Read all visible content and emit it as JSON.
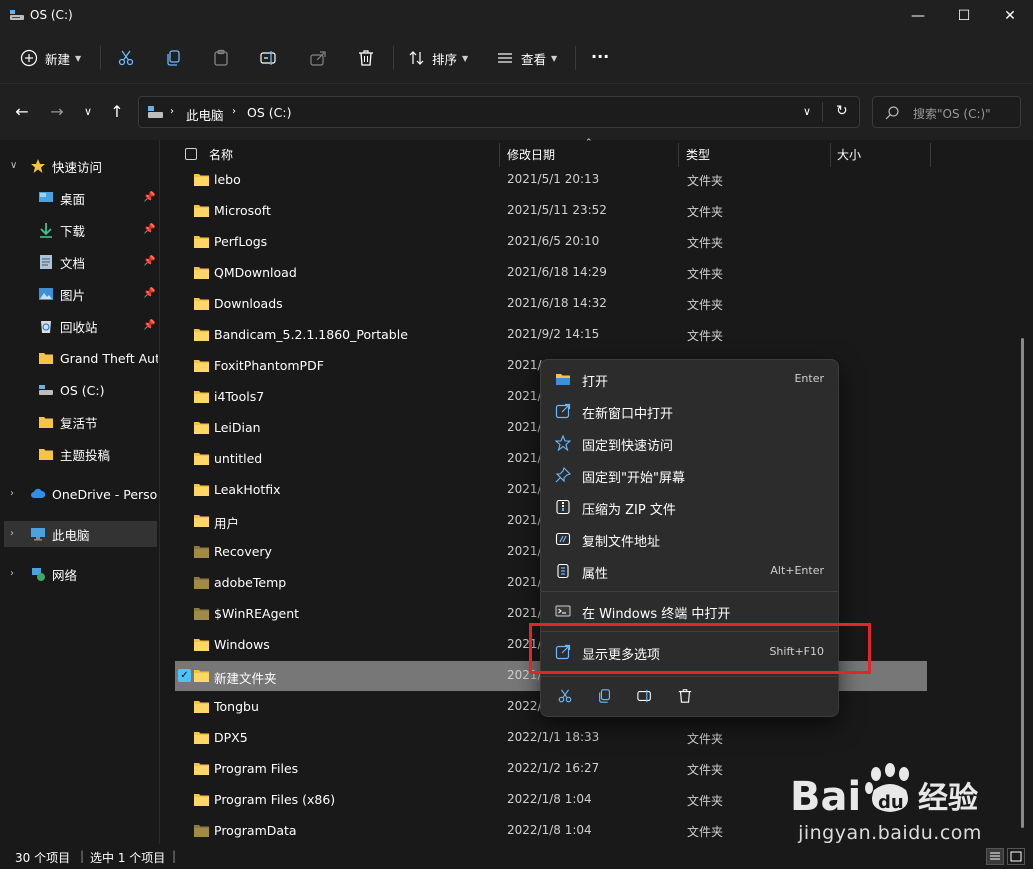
{
  "window": {
    "title": "OS (C:)",
    "minimize_label": "—",
    "maximize_label": "☐",
    "close_label": "✕"
  },
  "toolbar": {
    "new_label": "新建",
    "sort_label": "排序",
    "view_label": "查看",
    "more_label": "···"
  },
  "address": {
    "crumbs": [
      "此电脑",
      "OS (C:)"
    ],
    "search_placeholder": "搜索\"OS (C:)\""
  },
  "sidebar": {
    "items": [
      {
        "label": "快速访问",
        "icon": "star-icon"
      },
      {
        "label": "桌面",
        "icon": "desktop-icon",
        "pinned": true
      },
      {
        "label": "下载",
        "icon": "download-icon",
        "pinned": true
      },
      {
        "label": "文档",
        "icon": "document-icon",
        "pinned": true
      },
      {
        "label": "图片",
        "icon": "picture-icon",
        "pinned": true
      },
      {
        "label": "回收站",
        "icon": "recycle-bin-icon",
        "pinned": true
      },
      {
        "label": "Grand Theft Auto",
        "icon": "folder-icon"
      },
      {
        "label": "OS (C:)",
        "icon": "drive-icon"
      },
      {
        "label": "复活节",
        "icon": "folder-icon"
      },
      {
        "label": "主题投稿",
        "icon": "folder-icon"
      },
      {
        "label": "OneDrive - Person",
        "icon": "cloud-icon"
      },
      {
        "label": "此电脑",
        "icon": "computer-icon",
        "selected": true
      },
      {
        "label": "网络",
        "icon": "network-icon"
      }
    ]
  },
  "list": {
    "columns": [
      "名称",
      "修改日期",
      "类型",
      "大小"
    ],
    "rows": [
      {
        "name": "lebo",
        "date": "2021/5/1 20:13",
        "type": "文件夹"
      },
      {
        "name": "Microsoft",
        "date": "2021/5/11 23:52",
        "type": "文件夹"
      },
      {
        "name": "PerfLogs",
        "date": "2021/6/5 20:10",
        "type": "文件夹"
      },
      {
        "name": "QMDownload",
        "date": "2021/6/18 14:29",
        "type": "文件夹"
      },
      {
        "name": "Downloads",
        "date": "2021/6/18 14:32",
        "type": "文件夹"
      },
      {
        "name": "Bandicam_5.2.1.1860_Portable",
        "date": "2021/9/2 14:15",
        "type": "文件夹"
      },
      {
        "name": "FoxitPhantomPDF",
        "date": "2021/",
        "type": ""
      },
      {
        "name": "i4Tools7",
        "date": "2021/",
        "type": ""
      },
      {
        "name": "LeiDian",
        "date": "2021/",
        "type": ""
      },
      {
        "name": "untitled",
        "date": "2021/",
        "type": ""
      },
      {
        "name": "LeakHotfix",
        "date": "2021/",
        "type": ""
      },
      {
        "name": "用户",
        "date": "2021/",
        "type": ""
      },
      {
        "name": "Recovery",
        "date": "2021/",
        "type": ""
      },
      {
        "name": "adobeTemp",
        "date": "2021/",
        "type": ""
      },
      {
        "name": "$WinREAgent",
        "date": "2021/",
        "type": ""
      },
      {
        "name": "Windows",
        "date": "2021/",
        "type": ""
      },
      {
        "name": "新建文件夹",
        "date": "2021/",
        "type": "",
        "selected": true
      },
      {
        "name": "Tongbu",
        "date": "2022/",
        "type": ""
      },
      {
        "name": "DPX5",
        "date": "2022/1/1 18:33",
        "type": "文件夹"
      },
      {
        "name": "Program Files",
        "date": "2022/1/2 16:27",
        "type": "文件夹"
      },
      {
        "name": "Program Files (x86)",
        "date": "2022/1/8 1:04",
        "type": "文件夹"
      },
      {
        "name": "ProgramData",
        "date": "2022/1/8 1:04",
        "type": "文件夹"
      }
    ]
  },
  "context_menu": {
    "items": [
      {
        "label": "打开",
        "shortcut": "Enter",
        "icon": "folder-open-icon"
      },
      {
        "label": "在新窗口中打开",
        "shortcut": "",
        "icon": "open-new-window-icon"
      },
      {
        "label": "固定到快速访问",
        "shortcut": "",
        "icon": "star-outline-icon"
      },
      {
        "label": "固定到\"开始\"屏幕",
        "shortcut": "",
        "icon": "pin-icon"
      },
      {
        "label": "压缩为 ZIP 文件",
        "shortcut": "",
        "icon": "zip-icon"
      },
      {
        "label": "复制文件地址",
        "shortcut": "",
        "icon": "copy-path-icon"
      },
      {
        "label": "属性",
        "shortcut": "Alt+Enter",
        "icon": "properties-icon"
      },
      {
        "label": "在 Windows 终端 中打开",
        "shortcut": "",
        "icon": "terminal-icon"
      },
      {
        "label": "显示更多选项",
        "shortcut": "Shift+F10",
        "icon": "more-options-icon"
      }
    ],
    "quick_actions": [
      "cut-icon",
      "copy-icon",
      "rename-icon",
      "delete-icon"
    ]
  },
  "status": {
    "count": "30 个项目",
    "selected": "选中 1 个项目"
  },
  "watermark": {
    "brand": "Baidu经验",
    "url": "jingyan.baidu.com"
  },
  "colors": {
    "accent": "#4cc2ff",
    "folder": "#f6c343",
    "highlight_box": "#e0262b"
  }
}
